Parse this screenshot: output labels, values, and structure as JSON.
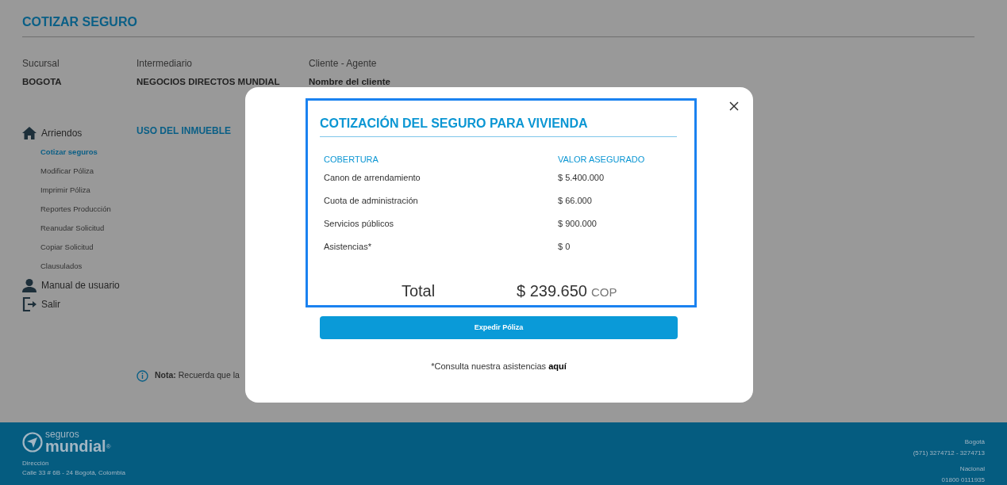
{
  "header": {
    "title": "COTIZAR SEGURO"
  },
  "info": [
    {
      "label": "Sucursal",
      "value": "BOGOTA"
    },
    {
      "label": "Intermediario",
      "value": "NEGOCIOS DIRECTOS MUNDIAL"
    },
    {
      "label": "Cliente - Agente",
      "value": "Nombre del cliente"
    }
  ],
  "sidebar": {
    "items": [
      {
        "label": "Arriendos",
        "children": [
          {
            "label": "Cotizar seguros",
            "selected": true
          },
          {
            "label": "Modificar Póliza",
            "selected": false
          },
          {
            "label": "Imprimir Póliza",
            "selected": false
          },
          {
            "label": "Reportes Producción",
            "selected": false
          },
          {
            "label": "Reanudar Solicitud",
            "selected": false
          },
          {
            "label": "Copiar Solicitud",
            "selected": false
          },
          {
            "label": "Clausulados",
            "selected": false
          }
        ]
      },
      {
        "label": "Manual de usuario"
      },
      {
        "label": "Salir"
      }
    ]
  },
  "section_title": "USO DEL INMUEBLE",
  "note": "**Nota:** Recuerda que la",
  "modal": {
    "title": "COTIZACIÓN DEL SEGURO PARA VIVIENDA",
    "columns": [
      "COBERTURA",
      "VALOR ASEGURADO"
    ],
    "rows": [
      {
        "coverage": "Canon de arrendamiento",
        "value": "$ 5.400.000"
      },
      {
        "coverage": "Cuota de administración",
        "value": "$ 66.000"
      },
      {
        "coverage": "Servicios públicos",
        "value": "$ 900.000"
      },
      {
        "coverage": "Asistencias*",
        "value": "$ 0"
      }
    ],
    "total": {
      "label": "Total",
      "amount": "$ 239.650",
      "currency": "COP"
    },
    "button": "Expedir Póliza",
    "footnote": {
      "text": "*Consulta nuestra asistencias",
      "link": "aquí"
    }
  },
  "footer": {
    "logo": {
      "top": "seguros",
      "bottom": "mundial",
      "mark": "®"
    },
    "address_label": "Dirección",
    "address": "Calle 33 # 6B - 24 Bogotá, Colombia",
    "contacts": [
      {
        "label": "Bogotá",
        "value": "(571) 3274712 - 3274713"
      },
      {
        "label": "Nacional",
        "value": "01800 0111935"
      }
    ]
  }
}
